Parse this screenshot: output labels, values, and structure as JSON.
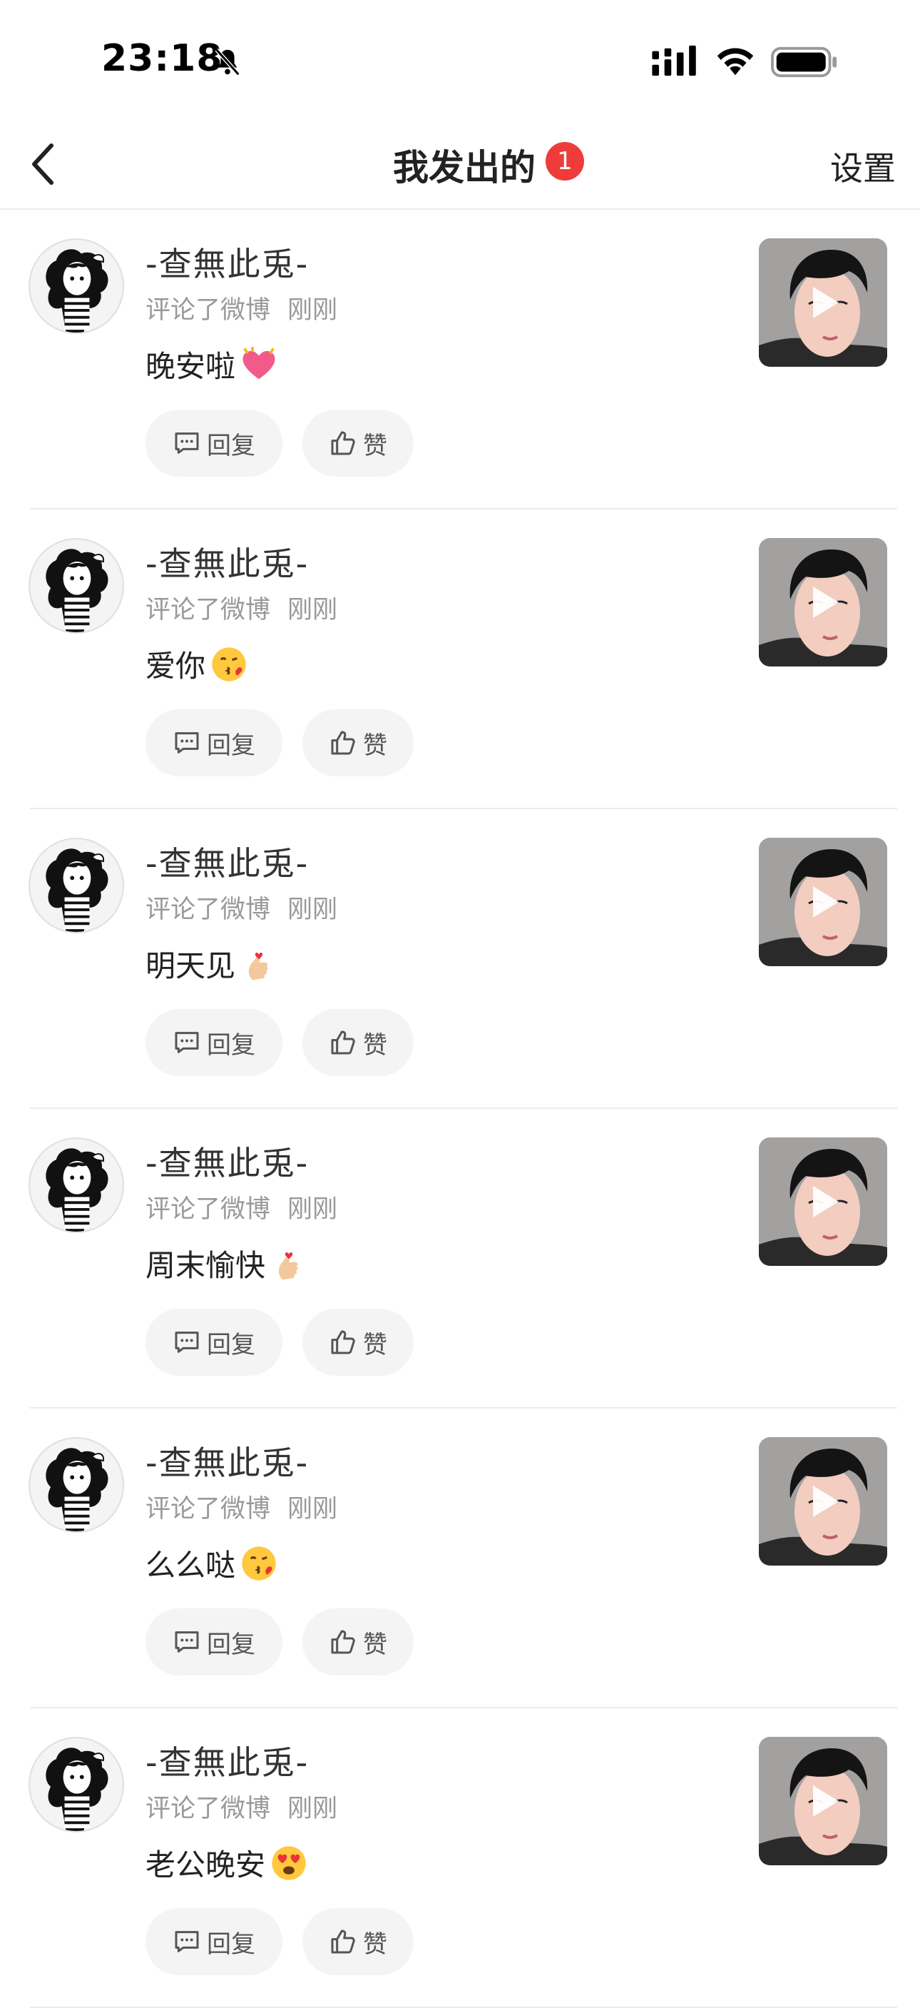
{
  "status_bar": {
    "time": "23:18",
    "icons": [
      "bell-slash-icon",
      "cellular-signal-icon",
      "wifi-icon",
      "battery-icon"
    ]
  },
  "nav": {
    "back_icon": "chevron-left-icon",
    "title": "我发出的",
    "badge": "1",
    "settings": "设置"
  },
  "colors": {
    "badge": "#f03b3b",
    "button_bg": "#f4f4f4",
    "meta_text": "#999999"
  },
  "items": [
    {
      "username": "-查無此兎-",
      "action": "评论了微博",
      "time": "刚刚",
      "comment": "晚安啦",
      "emoji": "heart-with-ribbon-emoji",
      "reply": "回复",
      "like": "赞"
    },
    {
      "username": "-查無此兎-",
      "action": "评论了微博",
      "time": "刚刚",
      "comment": "爱你",
      "emoji": "kissing-face-emoji",
      "reply": "回复",
      "like": "赞"
    },
    {
      "username": "-查無此兎-",
      "action": "评论了微博",
      "time": "刚刚",
      "comment": "明天见",
      "emoji": "finger-heart-emoji",
      "reply": "回复",
      "like": "赞"
    },
    {
      "username": "-查無此兎-",
      "action": "评论了微博",
      "time": "刚刚",
      "comment": "周末愉快",
      "emoji": "finger-heart-emoji",
      "reply": "回复",
      "like": "赞"
    },
    {
      "username": "-查無此兎-",
      "action": "评论了微博",
      "time": "刚刚",
      "comment": "么么哒",
      "emoji": "kissing-face-emoji",
      "reply": "回复",
      "like": "赞"
    },
    {
      "username": "-查無此兎-",
      "action": "评论了微博",
      "time": "刚刚",
      "comment": "老公晚安",
      "emoji": "heart-eyes-emoji",
      "reply": "回复",
      "like": "赞"
    }
  ]
}
